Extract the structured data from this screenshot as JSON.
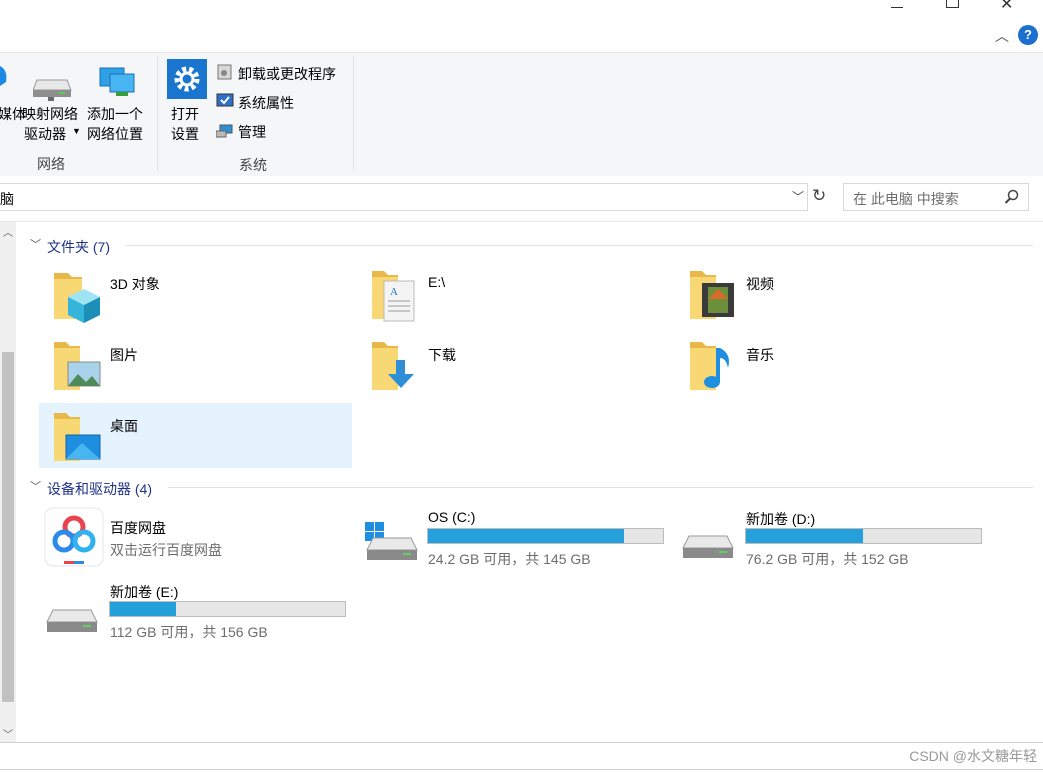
{
  "window": {
    "minimize_icon": "minimize-icon",
    "maximize_icon": "maximize-icon",
    "close_icon": "close-icon",
    "help": "?"
  },
  "ribbon": {
    "media_partial": "媒体",
    "map_drive_1": "映射网络",
    "map_drive_2": "驱动器",
    "add_location_1": "添加一个",
    "add_location_2": "网络位置",
    "network_group": "网络",
    "open_settings_1": "打开",
    "open_settings_2": "设置",
    "uninstall": "卸载或更改程序",
    "system_properties": "系统属性",
    "manage": "管理",
    "system_group": "系统"
  },
  "address": {
    "path": "脑",
    "search_placeholder": "在 此电脑 中搜索"
  },
  "folders": {
    "header": "文件夹 (7)",
    "items": [
      {
        "name": "3D 对象"
      },
      {
        "name": "E:\\"
      },
      {
        "name": "视频"
      },
      {
        "name": "图片"
      },
      {
        "name": "下载"
      },
      {
        "name": "音乐"
      },
      {
        "name": "桌面"
      }
    ]
  },
  "devices": {
    "header": "设备和驱动器 (4)",
    "baidu": {
      "name": "百度网盘",
      "desc": "双击运行百度网盘"
    },
    "drives": [
      {
        "name": "OS (C:)",
        "free": "24.2 GB 可用，共 145 GB",
        "used_fraction": 0.833
      },
      {
        "name": "新加卷 (D:)",
        "free": "76.2 GB 可用，共 152 GB",
        "used_fraction": 0.499
      },
      {
        "name": "新加卷 (E:)",
        "free": "112 GB 可用，共 156 GB",
        "used_fraction": 0.282
      }
    ]
  },
  "watermark": "CSDN @水文糖年轻",
  "colors": {
    "accent": "#26a0da",
    "section_text": "#1e3287",
    "selection": "#e5f3ff",
    "folder": "#f8d775"
  }
}
